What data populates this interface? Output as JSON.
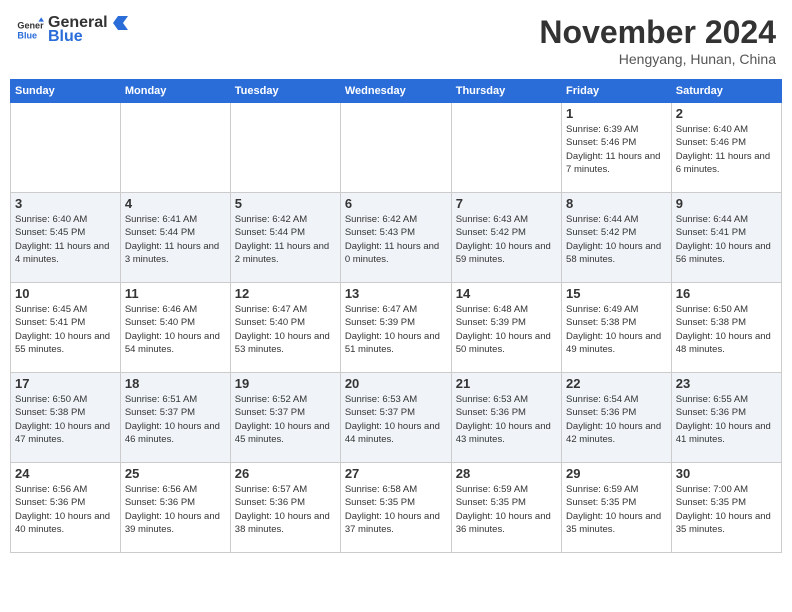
{
  "logo": {
    "line1": "General",
    "line2": "Blue"
  },
  "title": "November 2024",
  "location": "Hengyang, Hunan, China",
  "days_of_week": [
    "Sunday",
    "Monday",
    "Tuesday",
    "Wednesday",
    "Thursday",
    "Friday",
    "Saturday"
  ],
  "weeks": [
    [
      {
        "day": "",
        "info": ""
      },
      {
        "day": "",
        "info": ""
      },
      {
        "day": "",
        "info": ""
      },
      {
        "day": "",
        "info": ""
      },
      {
        "day": "",
        "info": ""
      },
      {
        "day": "1",
        "info": "Sunrise: 6:39 AM\nSunset: 5:46 PM\nDaylight: 11 hours and 7 minutes."
      },
      {
        "day": "2",
        "info": "Sunrise: 6:40 AM\nSunset: 5:46 PM\nDaylight: 11 hours and 6 minutes."
      }
    ],
    [
      {
        "day": "3",
        "info": "Sunrise: 6:40 AM\nSunset: 5:45 PM\nDaylight: 11 hours and 4 minutes."
      },
      {
        "day": "4",
        "info": "Sunrise: 6:41 AM\nSunset: 5:44 PM\nDaylight: 11 hours and 3 minutes."
      },
      {
        "day": "5",
        "info": "Sunrise: 6:42 AM\nSunset: 5:44 PM\nDaylight: 11 hours and 2 minutes."
      },
      {
        "day": "6",
        "info": "Sunrise: 6:42 AM\nSunset: 5:43 PM\nDaylight: 11 hours and 0 minutes."
      },
      {
        "day": "7",
        "info": "Sunrise: 6:43 AM\nSunset: 5:42 PM\nDaylight: 10 hours and 59 minutes."
      },
      {
        "day": "8",
        "info": "Sunrise: 6:44 AM\nSunset: 5:42 PM\nDaylight: 10 hours and 58 minutes."
      },
      {
        "day": "9",
        "info": "Sunrise: 6:44 AM\nSunset: 5:41 PM\nDaylight: 10 hours and 56 minutes."
      }
    ],
    [
      {
        "day": "10",
        "info": "Sunrise: 6:45 AM\nSunset: 5:41 PM\nDaylight: 10 hours and 55 minutes."
      },
      {
        "day": "11",
        "info": "Sunrise: 6:46 AM\nSunset: 5:40 PM\nDaylight: 10 hours and 54 minutes."
      },
      {
        "day": "12",
        "info": "Sunrise: 6:47 AM\nSunset: 5:40 PM\nDaylight: 10 hours and 53 minutes."
      },
      {
        "day": "13",
        "info": "Sunrise: 6:47 AM\nSunset: 5:39 PM\nDaylight: 10 hours and 51 minutes."
      },
      {
        "day": "14",
        "info": "Sunrise: 6:48 AM\nSunset: 5:39 PM\nDaylight: 10 hours and 50 minutes."
      },
      {
        "day": "15",
        "info": "Sunrise: 6:49 AM\nSunset: 5:38 PM\nDaylight: 10 hours and 49 minutes."
      },
      {
        "day": "16",
        "info": "Sunrise: 6:50 AM\nSunset: 5:38 PM\nDaylight: 10 hours and 48 minutes."
      }
    ],
    [
      {
        "day": "17",
        "info": "Sunrise: 6:50 AM\nSunset: 5:38 PM\nDaylight: 10 hours and 47 minutes."
      },
      {
        "day": "18",
        "info": "Sunrise: 6:51 AM\nSunset: 5:37 PM\nDaylight: 10 hours and 46 minutes."
      },
      {
        "day": "19",
        "info": "Sunrise: 6:52 AM\nSunset: 5:37 PM\nDaylight: 10 hours and 45 minutes."
      },
      {
        "day": "20",
        "info": "Sunrise: 6:53 AM\nSunset: 5:37 PM\nDaylight: 10 hours and 44 minutes."
      },
      {
        "day": "21",
        "info": "Sunrise: 6:53 AM\nSunset: 5:36 PM\nDaylight: 10 hours and 43 minutes."
      },
      {
        "day": "22",
        "info": "Sunrise: 6:54 AM\nSunset: 5:36 PM\nDaylight: 10 hours and 42 minutes."
      },
      {
        "day": "23",
        "info": "Sunrise: 6:55 AM\nSunset: 5:36 PM\nDaylight: 10 hours and 41 minutes."
      }
    ],
    [
      {
        "day": "24",
        "info": "Sunrise: 6:56 AM\nSunset: 5:36 PM\nDaylight: 10 hours and 40 minutes."
      },
      {
        "day": "25",
        "info": "Sunrise: 6:56 AM\nSunset: 5:36 PM\nDaylight: 10 hours and 39 minutes."
      },
      {
        "day": "26",
        "info": "Sunrise: 6:57 AM\nSunset: 5:36 PM\nDaylight: 10 hours and 38 minutes."
      },
      {
        "day": "27",
        "info": "Sunrise: 6:58 AM\nSunset: 5:35 PM\nDaylight: 10 hours and 37 minutes."
      },
      {
        "day": "28",
        "info": "Sunrise: 6:59 AM\nSunset: 5:35 PM\nDaylight: 10 hours and 36 minutes."
      },
      {
        "day": "29",
        "info": "Sunrise: 6:59 AM\nSunset: 5:35 PM\nDaylight: 10 hours and 35 minutes."
      },
      {
        "day": "30",
        "info": "Sunrise: 7:00 AM\nSunset: 5:35 PM\nDaylight: 10 hours and 35 minutes."
      }
    ]
  ]
}
